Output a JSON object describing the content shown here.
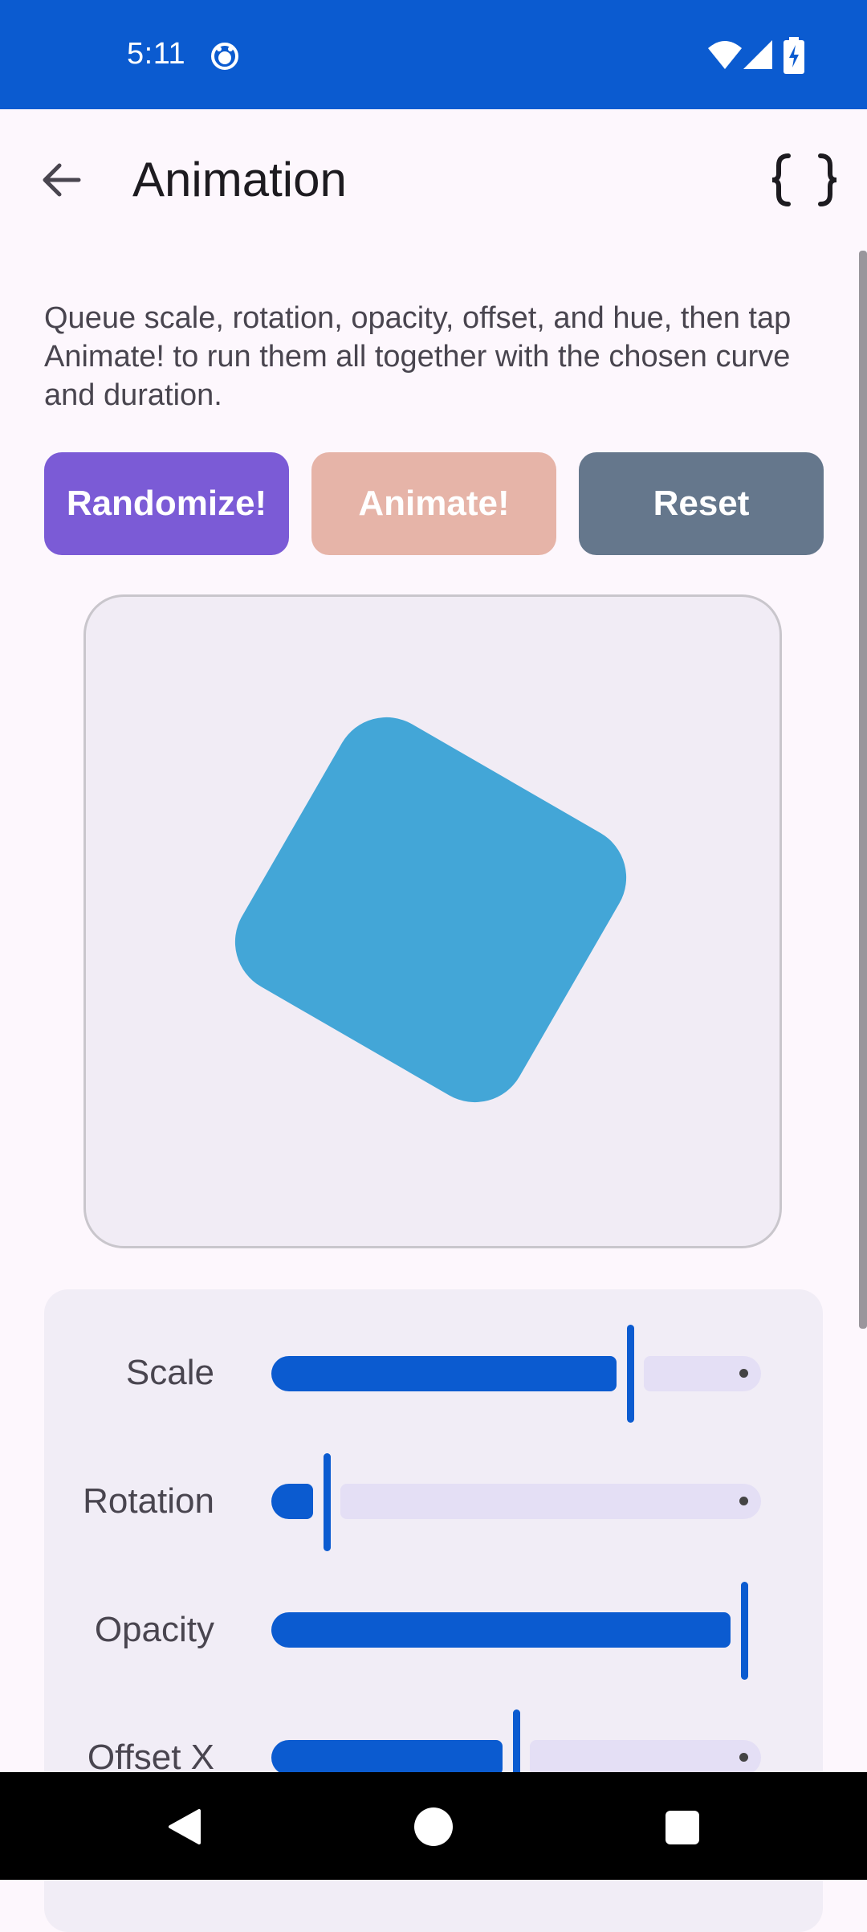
{
  "status_bar": {
    "time": "5:11"
  },
  "app_bar": {
    "title": "Animation"
  },
  "description": "Queue scale, rotation, opacity, offset, and hue, then tap Animate! to run them all together with the chosen curve and duration.",
  "buttons": {
    "randomize": "Randomize!",
    "animate": "Animate!",
    "reset": "Reset"
  },
  "colors": {
    "primary": "#0b5bd0",
    "randomize": "#7b5bd6",
    "animate": "#e6b4a8",
    "reset": "#65778c",
    "shape": "#43a6d7"
  },
  "preview": {
    "shape_rotation_deg": 30
  },
  "controls": {
    "scale": {
      "label": "Scale",
      "value_fraction": 0.73
    },
    "rotation": {
      "label": "Rotation",
      "value_fraction": 0.11
    },
    "opacity": {
      "label": "Opacity",
      "value_fraction": 0.97
    },
    "offset_x": {
      "label": "Offset X",
      "value_fraction": 0.5
    }
  },
  "icons": {
    "status": [
      "face-icon",
      "wifi-icon",
      "signal-icon",
      "battery-charging-icon"
    ],
    "app_bar": [
      "back-arrow-icon",
      "code-braces-icon"
    ],
    "nav": [
      "nav-back-icon",
      "nav-home-icon",
      "nav-recents-icon"
    ]
  }
}
